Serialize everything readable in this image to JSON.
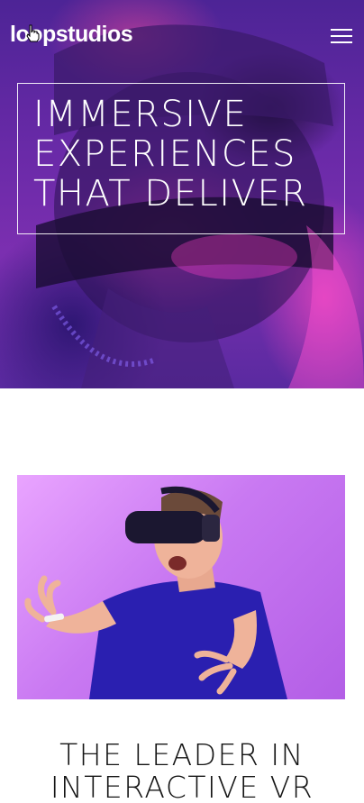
{
  "header": {
    "logo_text": "loopstudios",
    "menu_icon": "hamburger-icon"
  },
  "hero": {
    "headline_lines": [
      "IMMERSIVE",
      "EXPERIENCES",
      "THAT DELIVER"
    ],
    "image": "person-in-vr-headset-neon"
  },
  "feature": {
    "image": "man-wearing-vr-headset",
    "title_lines": [
      "THE LEADER IN",
      "INTERACTIVE VR"
    ]
  },
  "colors": {
    "hero_overlay": "#5a2aa0",
    "headline_text": "#ffffff",
    "feature_background": "#c979f2",
    "shirt": "#2a1fb0",
    "title_text": "#141414",
    "page_background": "#ffffff"
  }
}
